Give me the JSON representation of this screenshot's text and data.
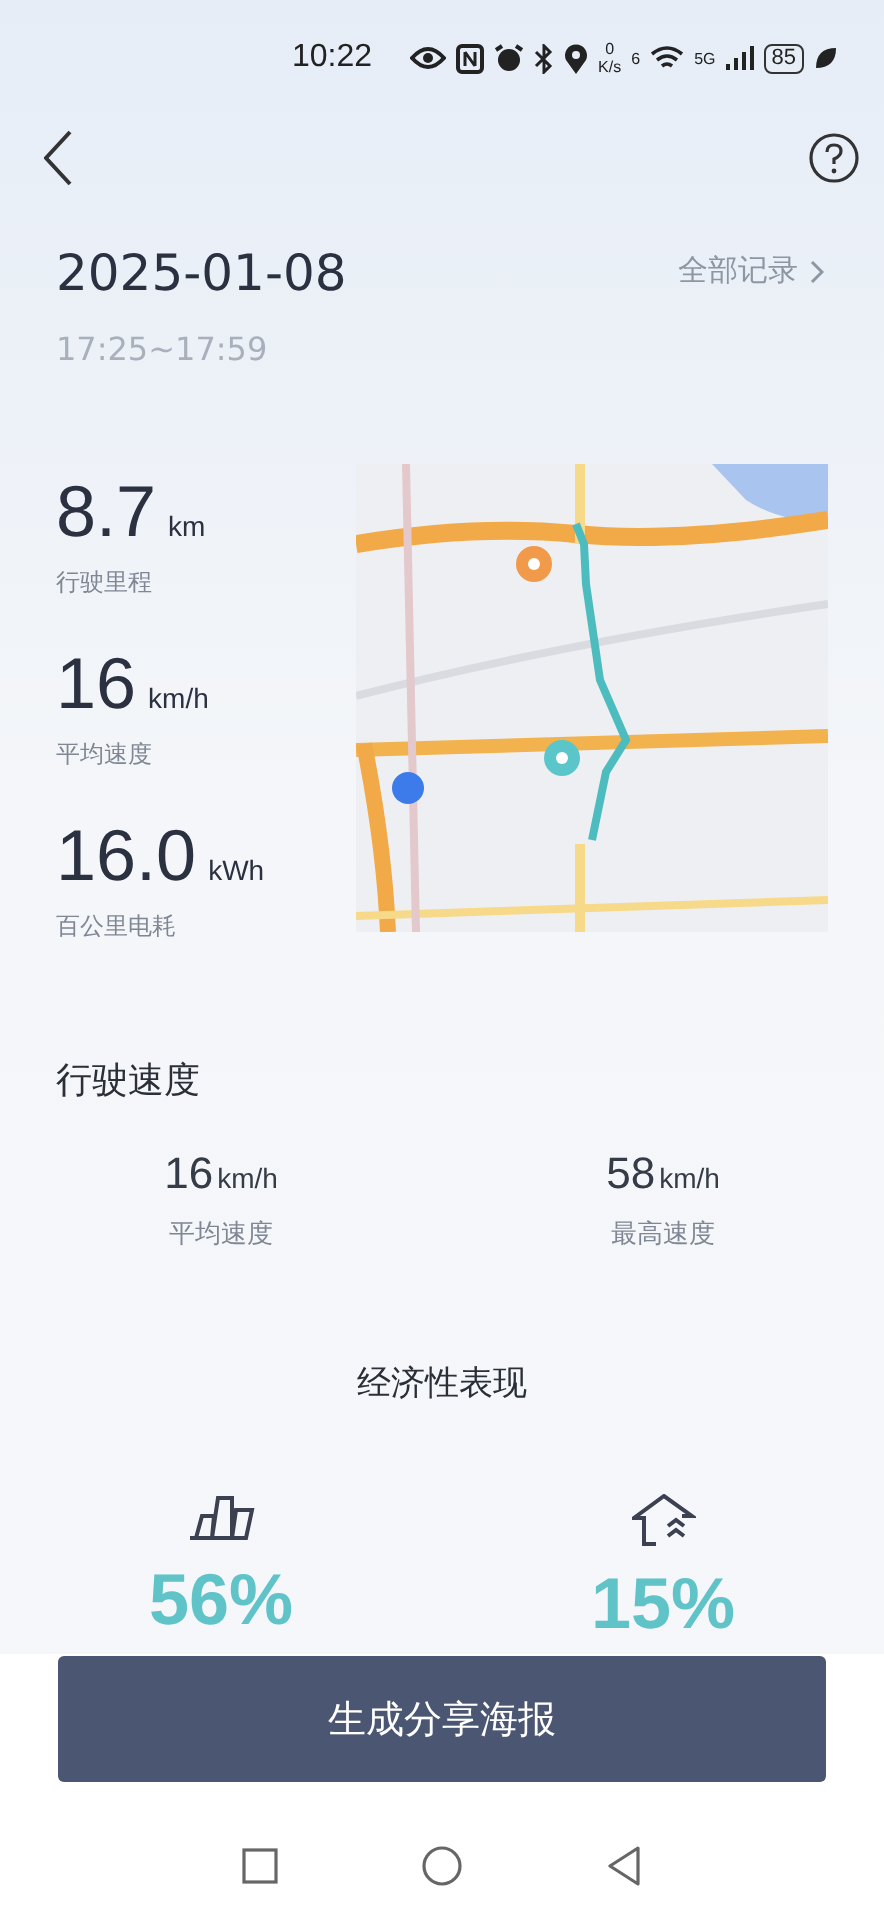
{
  "status_bar": {
    "time": "10:22",
    "net_speed_value": "0",
    "net_speed_unit": "K/s",
    "wifi_badge": "6",
    "network": "5G",
    "battery": "85"
  },
  "header": {
    "date": "2025-01-08",
    "time_range": "17:25~17:59",
    "all_records_link": "全部记录"
  },
  "stats": [
    {
      "value": "8.7",
      "unit": "km",
      "label": "行驶里程"
    },
    {
      "value": "16",
      "unit": "km/h",
      "label": "平均速度"
    },
    {
      "value": "16.0",
      "unit": "kWh",
      "label": "百公里电耗"
    }
  ],
  "speed_section": {
    "title": "行驶速度",
    "items": [
      {
        "value": "16",
        "unit": "km/h",
        "label": "平均速度"
      },
      {
        "value": "58",
        "unit": "km/h",
        "label": "最高速度"
      }
    ]
  },
  "economy_section": {
    "title": "经济性表现",
    "items": [
      {
        "kind": "bars",
        "value": "56%"
      },
      {
        "kind": "house",
        "value": "15%"
      }
    ]
  },
  "share_button": "生成分享海报"
}
